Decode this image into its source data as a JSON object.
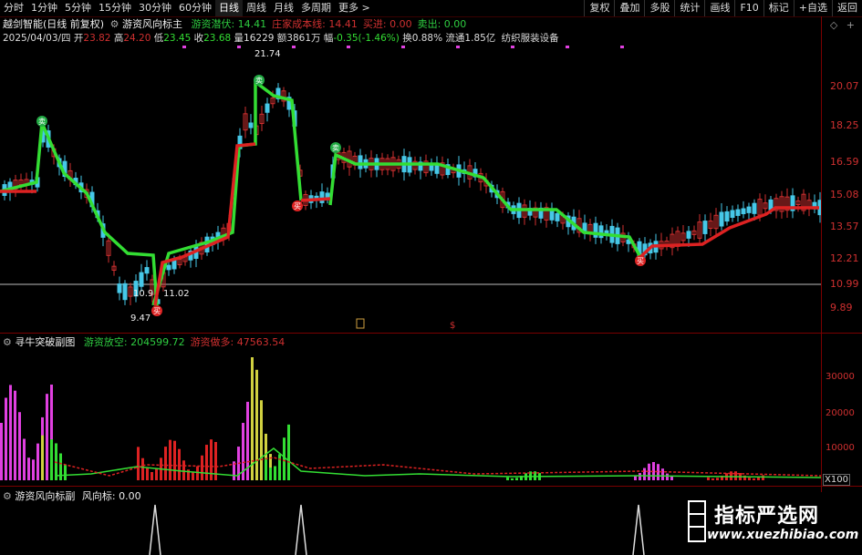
{
  "toolbar": {
    "tabs": [
      "分时",
      "1分钟",
      "5分钟",
      "15分钟",
      "30分钟",
      "60分钟",
      "日线",
      "周线",
      "月线",
      "多周期",
      "更多 >"
    ],
    "active_tab": "日线",
    "right_buttons": [
      "复权",
      "叠加",
      "多股",
      "统计",
      "画线",
      "F10",
      "标记",
      "+自选",
      "返回"
    ]
  },
  "header": {
    "stock": "越剑智能(日线 前复权)",
    "indicator_name": "游资风向标主",
    "line1_items": [
      {
        "label": "游资潜伏: 14.41",
        "color": "#2ecc40"
      },
      {
        "label": "庄家成本线: 14.41",
        "color": "#d03030"
      },
      {
        "label": "买进: 0.00",
        "color": "#d03030"
      },
      {
        "label": "卖出: 0.00",
        "color": "#2ecc40"
      }
    ],
    "line2": {
      "date": "2025/04/03/四",
      "open_label": "开",
      "open": "23.82",
      "high_label": "高",
      "high": "24.20",
      "low_label": "低",
      "low": "23.45",
      "close_label": "收",
      "close": "23.68",
      "vol_label": "量",
      "vol": "16229",
      "amt_label": "额",
      "amt": "3861万",
      "chg_label": "幅",
      "chg": "-0.35(-1.46%)",
      "turn_label": "换",
      "turn": "0.88%",
      "float_label": "流通",
      "float": "1.85亿",
      "industry": "纺织服装设备"
    }
  },
  "price_axis": [
    "20.07",
    "18.25",
    "16.59",
    "15.08",
    "13.57",
    "12.21",
    "10.99",
    "9.89"
  ],
  "annotations": {
    "high": "21.74",
    "low": "9.47",
    "mid1": "10.9",
    "mid2": "11.02"
  },
  "sub1": {
    "title": "寻牛突破副图",
    "items": [
      {
        "label": "游资放空: 204599.72",
        "color": "#2ecc40"
      },
      {
        "label": "游资做多: 47563.54",
        "color": "#d03030"
      }
    ],
    "axis": [
      "30000",
      "20000",
      "10000"
    ],
    "unit": "X100"
  },
  "sub2": {
    "title": "游资风向标副",
    "value": "风向标: 0.00"
  },
  "watermark": {
    "line1": "指标严选网",
    "line2": "www.xuezhibiao.com"
  },
  "marks": {
    "buy": "买",
    "sell": "卖"
  },
  "colors": {
    "up": "#d03030",
    "down": "#46c8e8",
    "green": "#33dd33",
    "red": "#dd2222",
    "axis": "#7a0000"
  }
}
